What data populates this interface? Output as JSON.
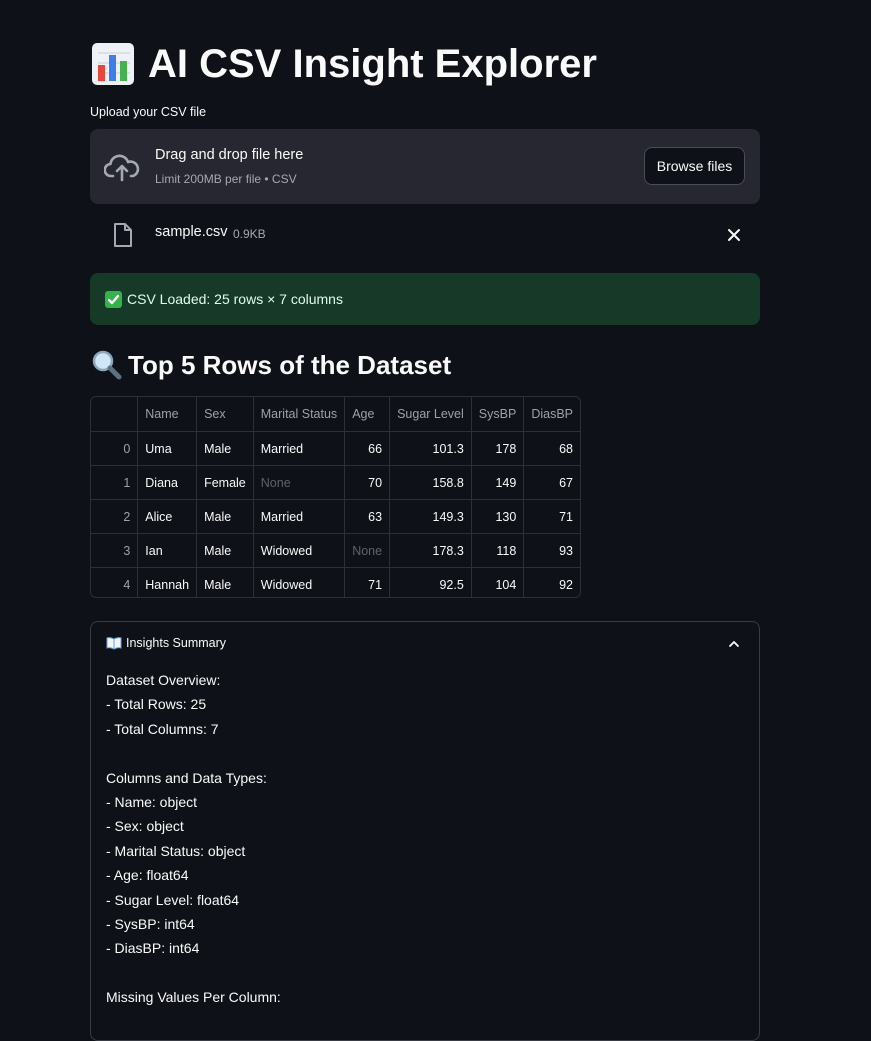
{
  "title": "AI CSV Insight Explorer",
  "uploader": {
    "label": "Upload your CSV file",
    "drop_title": "Drag and drop file here",
    "drop_sub": "Limit 200MB per file • CSV",
    "browse_label": "Browse files",
    "file_name": "sample.csv",
    "file_size": "0.9KB"
  },
  "success_message": "CSV Loaded: 25 rows × 7 columns",
  "section_title": "Top 5 Rows of the Dataset",
  "table": {
    "columns": [
      "Name",
      "Sex",
      "Marital Status",
      "Age",
      "Sugar Level",
      "SysBP",
      "DiasBP"
    ],
    "rows": [
      {
        "index": "0",
        "cells": [
          "Uma",
          "Male",
          "Married",
          "66",
          "101.3",
          "178",
          "68"
        ]
      },
      {
        "index": "1",
        "cells": [
          "Diana",
          "Female",
          "None",
          "70",
          "158.8",
          "149",
          "67"
        ]
      },
      {
        "index": "2",
        "cells": [
          "Alice",
          "Male",
          "Married",
          "63",
          "149.3",
          "130",
          "71"
        ]
      },
      {
        "index": "3",
        "cells": [
          "Ian",
          "Male",
          "Widowed",
          "None",
          "178.3",
          "118",
          "93"
        ]
      },
      {
        "index": "4",
        "cells": [
          "Hannah",
          "Male",
          "Widowed",
          "71",
          "92.5",
          "104",
          "92"
        ]
      }
    ]
  },
  "insights": {
    "header": "Insights Summary",
    "lines": [
      "Dataset Overview:",
      "- Total Rows: 25",
      "- Total Columns: 7",
      "",
      "Columns and Data Types:",
      "- Name: object",
      "- Sex: object",
      "- Marital Status: object",
      "- Age: float64",
      "- Sugar Level: float64",
      "- SysBP: int64",
      "- DiasBP: int64",
      "",
      "Missing Values Per Column:"
    ]
  },
  "colors": {
    "background": "#0e1117",
    "panel": "#262730",
    "success_bg": "#173928",
    "success_text": "#dffde9"
  }
}
